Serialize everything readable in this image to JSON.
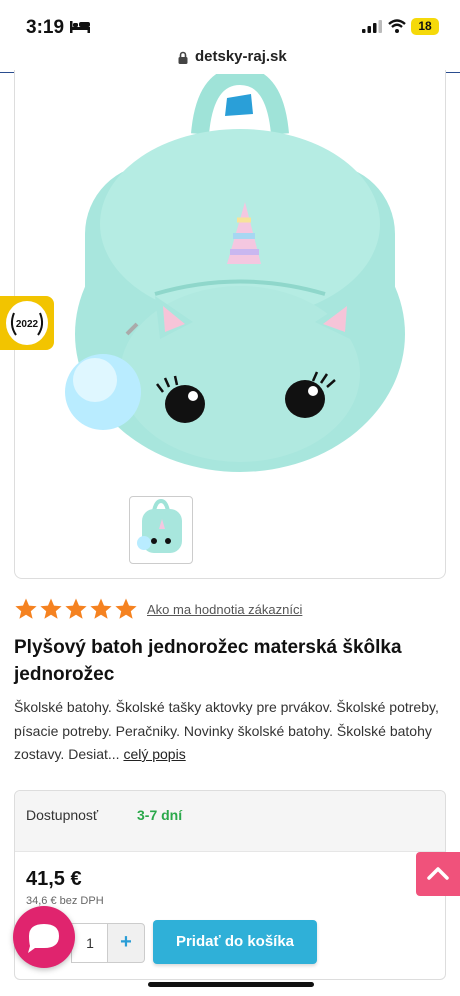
{
  "status_bar": {
    "time": "3:19",
    "battery": "18"
  },
  "browser": {
    "url": "detsky-raj.sk"
  },
  "product": {
    "rating_stars": 5,
    "reviews_link": "Ako ma hodnotia zákazníci",
    "title": "Plyšový batoh jednorožec materská škôlka jednorožec",
    "description": "Školské batohy. Školské tašky aktovky pre prvákov. Školské potreby, písacie potreby. Peračniky. Novinky školské batohy. Školské batohy zostavy. Desiat...",
    "full_description_link": "celý popis"
  },
  "award_badge": {
    "year": "2022"
  },
  "buy_box": {
    "availability_label": "Dostupnosť",
    "availability_value": "3-7 dní",
    "price": "41,5 €",
    "price_without_vat": "34,6 € bez DPH",
    "quantity": "1",
    "plus_label": "+",
    "add_to_cart": "Pridať do košíka"
  },
  "colors": {
    "accent": "#2fb0d8",
    "star": "#f58220",
    "availability": "#2aa84a",
    "scroll_top": "#f0527b",
    "chat": "#e0246e"
  }
}
